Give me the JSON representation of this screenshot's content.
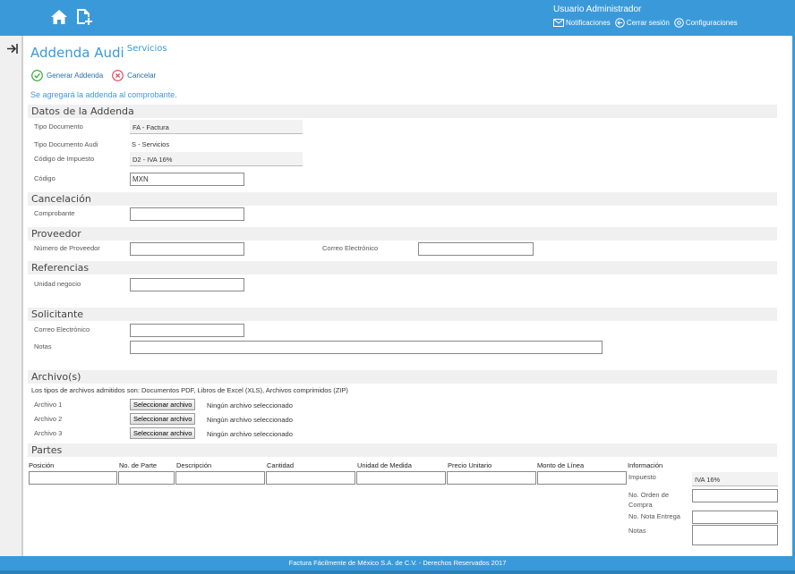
{
  "header": {
    "user_name": "Usuario Administrador",
    "links": {
      "notifications": "Notificaciones",
      "logout": "Cerrar sesión",
      "settings": "Configuraciones"
    }
  },
  "page": {
    "title": "Addenda Audi",
    "subtitle": "Servicios",
    "actions": {
      "generate": "Generar Addenda",
      "cancel": "Cancelar"
    },
    "note": "Se agregará la addenda al comprobante."
  },
  "datos": {
    "title": "Datos de la Addenda",
    "tipo_documento": {
      "label": "Tipo Documento",
      "value": "FA - Factura"
    },
    "tipo_documento_audi": {
      "label": "Tipo Documento Audi",
      "value": "S - Servicios"
    },
    "codigo_impuesto": {
      "label": "Código de Impuesto",
      "value": "D2 - IVA 16%"
    },
    "codigo": {
      "label": "Código",
      "value": "MXN"
    }
  },
  "cancelacion": {
    "title": "Cancelación",
    "comprobante": {
      "label": "Comprobante",
      "value": ""
    }
  },
  "proveedor": {
    "title": "Proveedor",
    "numero": {
      "label": "Número de Proveedor",
      "value": ""
    },
    "correo": {
      "label": "Correo Electrónico",
      "value": ""
    }
  },
  "referencias": {
    "title": "Referencias",
    "unidad": {
      "label": "Unidad negocio",
      "value": ""
    }
  },
  "solicitante": {
    "title": "Solicitante",
    "correo": {
      "label": "Correo Electrónico",
      "value": ""
    },
    "notas": {
      "label": "Notas",
      "value": ""
    }
  },
  "archivos": {
    "title": "Archivo(s)",
    "description": "Los tipos de archivos admitidos son: Documentos PDF, Libros de Excel (XLS), Archivos comprimidos (ZIP)",
    "button_label": "Seleccionar archivo",
    "no_file": "Ningún archivo seleccionado",
    "items": [
      {
        "label": "Archivo 1"
      },
      {
        "label": "Archivo 2"
      },
      {
        "label": "Archivo 3"
      }
    ]
  },
  "partes": {
    "title": "Partes",
    "columns": [
      "Posición",
      "No. de Parte",
      "Descripción",
      "Cantidad",
      "Unidad de Medida",
      "Precio Unitario",
      "Monto de Línea",
      "Información"
    ],
    "info": {
      "impuesto": {
        "label": "Impuesto",
        "value": "IVA 16%"
      },
      "orden_compra": {
        "label": "No. Orden de Compra"
      },
      "nota_entrega": {
        "label": "No. Nota Entrega"
      },
      "notas": {
        "label": "Notas"
      }
    }
  },
  "footer": {
    "text": "Factura Fácilmente de México S.A. de C.V. - Derechos Reservados 2017"
  },
  "colors": {
    "primary": "#3a9ad9",
    "success": "#2aa52a",
    "danger": "#e0405a"
  },
  "icons": [
    "home-icon",
    "new-document-icon",
    "mail-icon",
    "logout-icon",
    "settings-icon",
    "expand-icon",
    "check-circle-icon",
    "cancel-circle-icon"
  ]
}
